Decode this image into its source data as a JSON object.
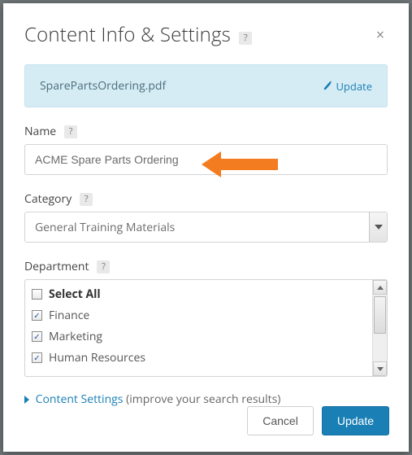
{
  "title": "Content Info & Settings",
  "help": "?",
  "file": {
    "name": "SparePartsOrdering.pdf",
    "update_label": "Update"
  },
  "name_field": {
    "label": "Name",
    "value": "ACME Spare Parts Ordering"
  },
  "category": {
    "label": "Category",
    "selected": "General Training Materials"
  },
  "department": {
    "label": "Department",
    "select_all": "Select All",
    "items": [
      {
        "label": "Finance",
        "checked": true
      },
      {
        "label": "Marketing",
        "checked": true
      },
      {
        "label": "Human Resources",
        "checked": true
      }
    ]
  },
  "content_settings": {
    "link": "Content Settings",
    "hint": "(improve your search results)"
  },
  "buttons": {
    "cancel": "Cancel",
    "update": "Update"
  }
}
